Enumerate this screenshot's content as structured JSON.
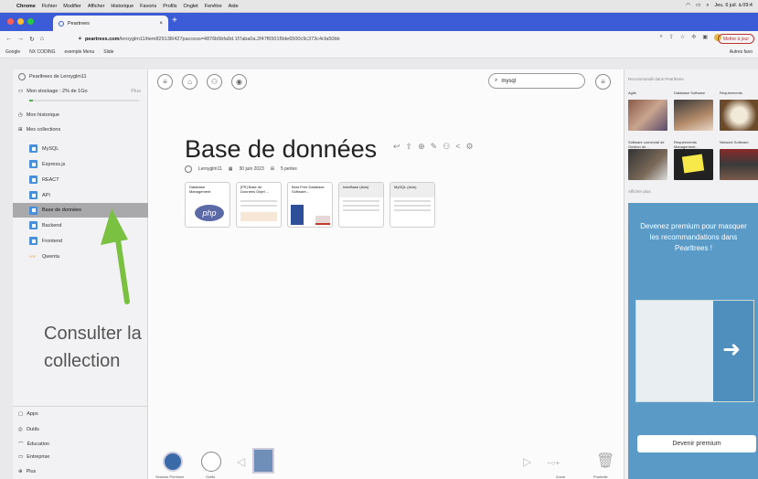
{
  "macbar": {
    "apple": "",
    "menus": [
      "Chrome",
      "Fichier",
      "Modifier",
      "Afficher",
      "Historique",
      "Favoris",
      "Profils",
      "Onglet",
      "Fenêtre",
      "Aide"
    ],
    "clock": "Jeu. 6 juil. à 09:4"
  },
  "browser": {
    "tab_title": "Peartrees",
    "tab_close": "×",
    "new_tab": "+",
    "url_host": "peartrees.com",
    "url_path": "/leroyglm11/item829138/427paccess=4876b5bfa9d.1f7aba0a.2f47f6501f9de6500c9c373c4cfa50bb",
    "update_button": "Mettre à jour",
    "bookmarks": [
      "Google",
      "NX CODING",
      "exemple Menu",
      "Slide"
    ],
    "bookmarks_right": "Autres favo"
  },
  "sidebar": {
    "account": "Pearltrees de Leroyglm11",
    "storage": "Mon stockage : 2% de 1Go",
    "plus": "Plus",
    "history": "Mon historique",
    "collections_header": "Mes collections",
    "items": [
      {
        "label": "MySQL"
      },
      {
        "label": "Express.js"
      },
      {
        "label": "REACT"
      },
      {
        "label": "API"
      },
      {
        "label": "Base de données",
        "selected": true
      },
      {
        "label": "Backend"
      },
      {
        "label": "Frontend"
      },
      {
        "label": "Qwenta"
      }
    ],
    "bottom": [
      "Apps",
      "Outils",
      "Éducation",
      "Entreprise",
      "Plus"
    ]
  },
  "main": {
    "search_value": "mysql",
    "title": "Base de données",
    "author": "Leroyglm11",
    "date": "30 juin 2023",
    "count": "5 perles",
    "thumbs": [
      {
        "title": "Database Management"
      },
      {
        "title": "[FR] Base de Données Objet ..."
      },
      {
        "title": "Best Free Database Software..."
      },
      {
        "title": "InterBase (Avis)"
      },
      {
        "title": "MySQL (Avis)"
      }
    ],
    "bottom_labels": {
      "left1": "Session Premium",
      "left2": "Outils",
      "zoom": "Zoom",
      "trash": "Poubelle"
    }
  },
  "overlay": {
    "line1": "Consulter la",
    "line2": "collection"
  },
  "right": {
    "header": "Recommandé dans Pearltrees",
    "cards": [
      {
        "label": "Agile"
      },
      {
        "label": "Database Software"
      },
      {
        "label": "Requirements"
      },
      {
        "label": "Software comercial de Gestion de..."
      },
      {
        "label": "Requirements Management..."
      },
      {
        "label": "Network Software"
      }
    ],
    "see_more": "Afficher plus",
    "premium_text": "Devenez premium pour masquer les recommandations dans Pearltrees !",
    "premium_button": "Devenir premium"
  },
  "colors": {
    "accent": "#3c5bd6",
    "premium": "#5a9ac7",
    "arrow": "#7ac142",
    "folder": "#4a8fd9"
  }
}
